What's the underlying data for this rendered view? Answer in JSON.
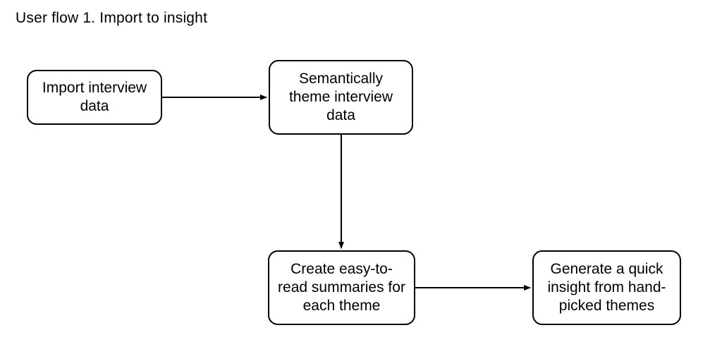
{
  "diagram": {
    "title": "User flow 1. Import to insight",
    "nodes": {
      "n1": {
        "label": "Import interview data"
      },
      "n2": {
        "label": "Semantically theme interview data"
      },
      "n3": {
        "label": "Create easy-to-read summaries for each theme"
      },
      "n4": {
        "label": "Generate a quick insight from hand-picked themes"
      }
    },
    "edges": [
      {
        "from": "n1",
        "to": "n2",
        "direction": "right"
      },
      {
        "from": "n2",
        "to": "n3",
        "direction": "down"
      },
      {
        "from": "n3",
        "to": "n4",
        "direction": "right"
      }
    ],
    "style": {
      "stroke": "#000000",
      "background": "#ffffff",
      "strokeWidth": 2,
      "borderRadius": 14
    }
  }
}
